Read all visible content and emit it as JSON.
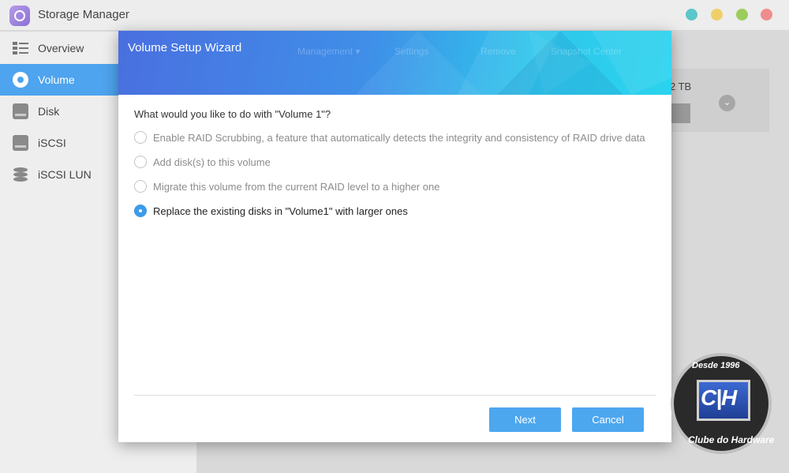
{
  "app": {
    "title": "Storage Manager",
    "window_buttons": [
      {
        "name": "window-button-teal",
        "color": "#5bc6c9"
      },
      {
        "name": "window-button-yellow",
        "color": "#f0cf6a"
      },
      {
        "name": "window-button-green",
        "color": "#9ccd5c"
      },
      {
        "name": "window-button-red",
        "color": "#ef8d8d"
      }
    ]
  },
  "sidebar": {
    "items": [
      {
        "label": "Overview",
        "icon": "overview-icon",
        "active": false
      },
      {
        "label": "Volume",
        "icon": "volume-icon",
        "active": true
      },
      {
        "label": "Disk",
        "icon": "disk-icon",
        "active": false
      },
      {
        "label": "iSCSI",
        "icon": "iscsi-icon",
        "active": false
      },
      {
        "label": "iSCSI LUN",
        "icon": "iscsi-lun-icon",
        "active": false
      }
    ]
  },
  "background": {
    "toolbar_items": [
      "Management ▾",
      "Settings",
      "Remove",
      "Snapshot Center"
    ],
    "card_capacity": "2 TB"
  },
  "dialog": {
    "title": "Volume Setup Wizard",
    "question": "What would you like to do with \"Volume 1\"?",
    "options": [
      {
        "label": "Enable RAID Scrubbing, a feature that automatically detects the integrity and consistency of RAID drive data",
        "checked": false
      },
      {
        "label": "Add disk(s) to this volume",
        "checked": false
      },
      {
        "label": "Migrate this volume from the current RAID level to a higher one",
        "checked": false
      },
      {
        "label": "Replace the existing disks in \"Volume1\" with larger ones",
        "checked": true
      }
    ],
    "next_label": "Next",
    "cancel_label": "Cancel"
  },
  "watermark": {
    "top_text": "Desde 1996",
    "logo_text": "C|H",
    "bottom_text": "Clube do Hardware"
  },
  "colors": {
    "accent": "#4da7ef",
    "sidebar_active": "#4ea4ee"
  }
}
